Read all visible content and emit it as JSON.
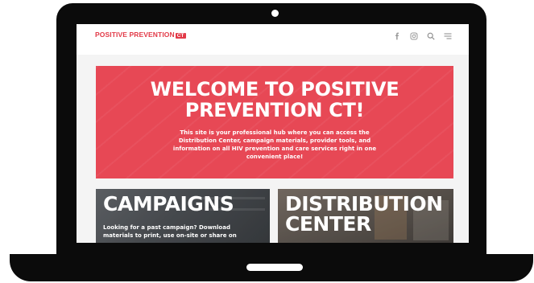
{
  "header": {
    "logo_text": "POSITIVE PREVENTION",
    "logo_badge": "CT",
    "icons": [
      "facebook-icon",
      "instagram-icon",
      "search-icon",
      "menu-icon"
    ]
  },
  "hero": {
    "title_line1": "WELCOME TO POSITIVE",
    "title_line2": "PREVENTION CT!",
    "body": "This site is your professional hub where you can access the Distribution Center, campaign materials, provider tools, and information on all HIV prevention and care services right in one convenient place!"
  },
  "cards": {
    "campaigns": {
      "title": "CAMPAIGNS",
      "text": "Looking for a past campaign? Download materials to print, use on-site or share on"
    },
    "distribution": {
      "title_line1": "DISTRIBUTION",
      "title_line2": "CENTER"
    }
  },
  "colors": {
    "brand_red": "#e23a48",
    "hero_red": "#e74855",
    "device": "#0b0b0b"
  }
}
